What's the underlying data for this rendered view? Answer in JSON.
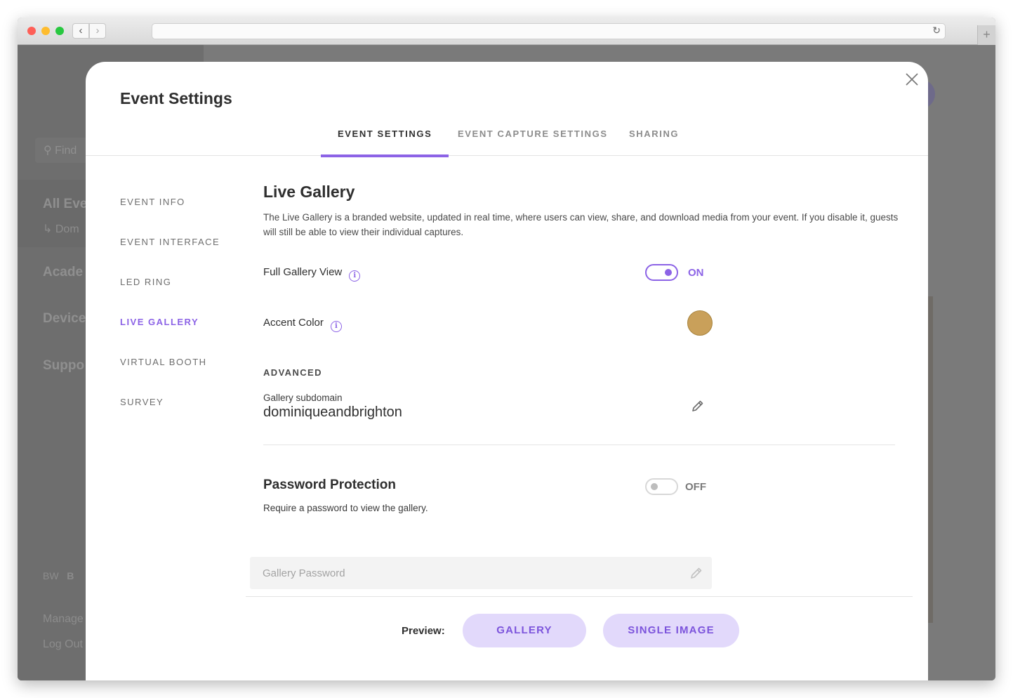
{
  "browser": {
    "url": ""
  },
  "background": {
    "search_placeholder": "Find",
    "items": [
      "All Eve",
      "Acade",
      "Device",
      "Suppo"
    ],
    "sub_item": "Dom",
    "avatar": "BW",
    "avatar_name": "B",
    "manage": "Manage",
    "logout": "Log Out"
  },
  "modal": {
    "title": "Event Settings",
    "tabs": [
      {
        "label": "EVENT SETTINGS",
        "active": true
      },
      {
        "label": "EVENT CAPTURE SETTINGS",
        "active": false
      },
      {
        "label": "SHARING",
        "active": false
      }
    ],
    "side_nav": [
      {
        "label": "EVENT INFO",
        "active": false
      },
      {
        "label": "EVENT INTERFACE",
        "active": false
      },
      {
        "label": "LED RING",
        "active": false
      },
      {
        "label": "LIVE GALLERY",
        "active": true
      },
      {
        "label": "VIRTUAL BOOTH",
        "active": false
      },
      {
        "label": "SURVEY",
        "active": false
      }
    ]
  },
  "live_gallery": {
    "heading": "Live Gallery",
    "description": "The Live Gallery is a branded website, updated in real time, where users can view, share, and download media from your event. If you disable it, guests will still be able to view their individual captures.",
    "full_gallery": {
      "label": "Full Gallery View",
      "state": "ON"
    },
    "accent": {
      "label": "Accent Color",
      "color": "#c9a05a"
    },
    "advanced_label": "ADVANCED",
    "subdomain": {
      "label": "Gallery subdomain",
      "value": "dominiqueandbrighton"
    }
  },
  "password": {
    "heading": "Password Protection",
    "description": "Require a password to view the gallery.",
    "state": "OFF",
    "placeholder": "Gallery Password"
  },
  "preview": {
    "label": "Preview:",
    "gallery_button": "GALLERY",
    "single_button": "SINGLE IMAGE"
  },
  "colors": {
    "accent": "#8c63e6",
    "button_bg": "#e2d9fb"
  }
}
